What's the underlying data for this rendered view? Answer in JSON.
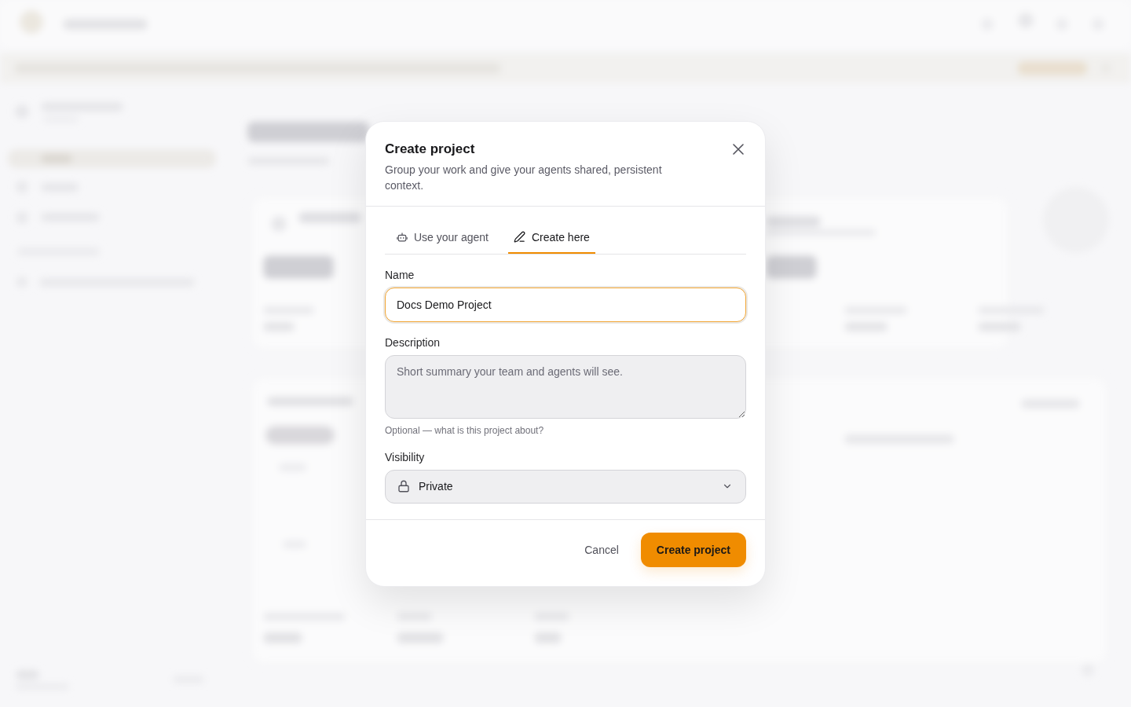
{
  "dialog": {
    "title": "Create project",
    "description": "Group your work and give your agents shared, persistent context.",
    "tabs": [
      {
        "label": "Use your agent",
        "kind": "agent",
        "selected": false
      },
      {
        "label": "Create here",
        "kind": "edit",
        "selected": true
      }
    ],
    "fields": [
      {
        "kind": "text",
        "label": "Name",
        "value": "Docs Demo Project",
        "focused": true
      },
      {
        "kind": "textarea",
        "label": "Description",
        "placeholder": "Short summary your team and agents will see.",
        "hint": "Optional — what is this project about?",
        "focused": false
      },
      {
        "kind": "select",
        "label": "Visibility",
        "value": "Private",
        "focused": false
      }
    ],
    "buttons": [
      {
        "label": "Cancel",
        "kind": "cancel"
      },
      {
        "label": "Create project",
        "kind": "submit"
      }
    ]
  }
}
